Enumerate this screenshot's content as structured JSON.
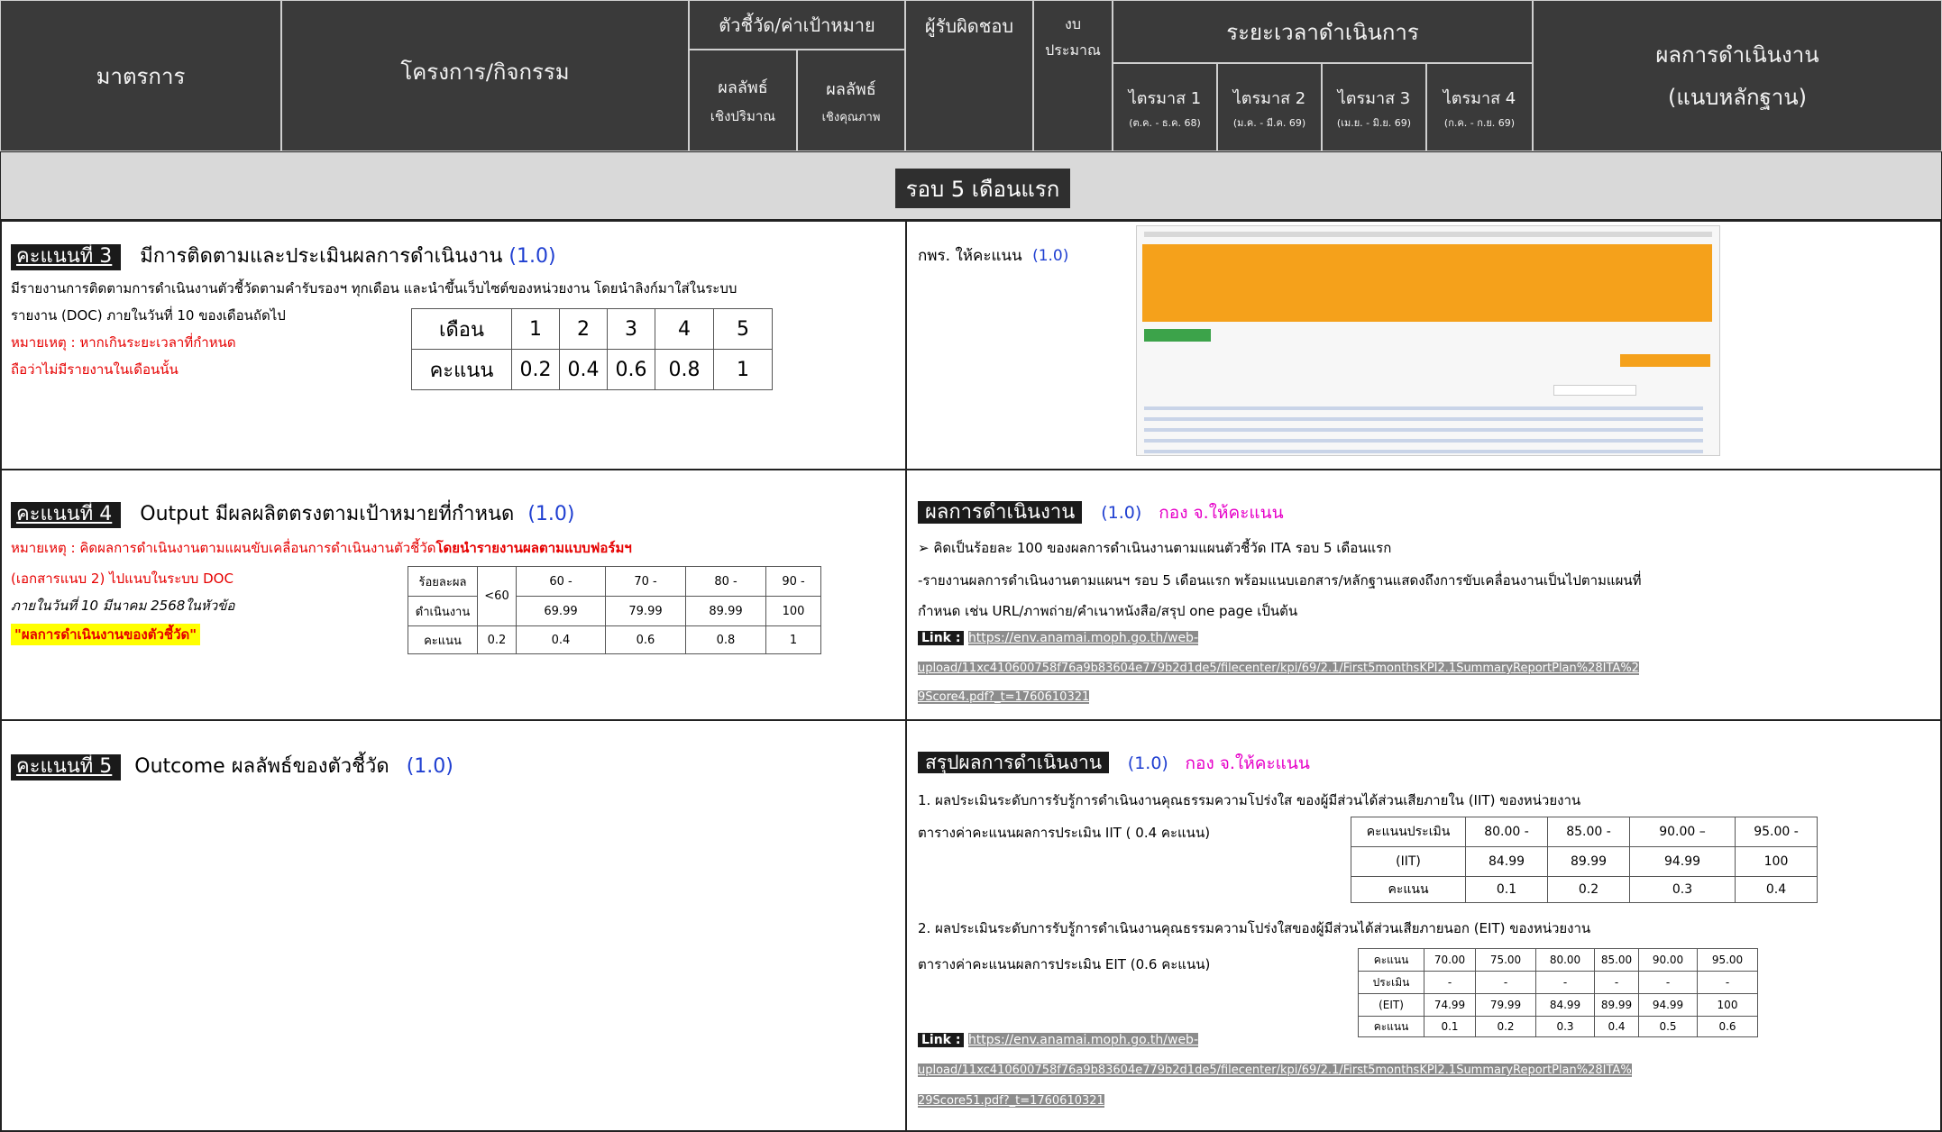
{
  "header": {
    "measure": "มาตรการ",
    "project": "โครงการ/กิจกรรม",
    "indicator": "ตัวชี้วัด/ค่าเป้าหมาย",
    "quantitative_1": "ผลลัพธ์",
    "quantitative_2": "เชิงปริมาณ",
    "qualitative_1": "ผลลัพธ์",
    "qualitative_2": "เชิงคุณภาพ",
    "responsible": "ผู้รับผิดชอบ",
    "budget_1": "งบ",
    "budget_2": "ประมาณ",
    "timeline": "ระยะเวลาดำเนินการ",
    "quarters": [
      {
        "label": "ไตรมาส 1",
        "range": "(ต.ค. - ธ.ค. 68)"
      },
      {
        "label": "ไตรมาส 2",
        "range": "(ม.ค. - มี.ค. 69)"
      },
      {
        "label": "ไตรมาส 3",
        "range": "(เม.ย. - มิ.ย. 69)"
      },
      {
        "label": "ไตรมาส 4",
        "range": "(ก.ค. - ก.ย. 69)"
      }
    ],
    "result_1": "ผลการดำเนินงาน",
    "result_2": "(แนบหลักฐาน)"
  },
  "round_title": "รอบ 5 เดือนแรก",
  "score3": {
    "tag": "คะแนนที่ 3",
    "title": "มีการติดตามและประเมินผลการดำเนินงาน",
    "weight": "(1.0)",
    "desc_1": "มีรายงานการติดตามการดำเนินงานตัวชี้วัดตามคำรับรองฯ ทุกเดือน และนำขึ้นเว็บไซต์ของหน่วยงาน โดยนำลิงก์มาใส่ในระบบ",
    "desc_2": "รายงาน (DOC) ภายในวันที่ 10 ของเดือนถัดไป",
    "note_1": "หมายเหตุ : หากเกินระยะเวลาที่กำหนด",
    "note_2": "ถือว่าไม่มีรายงานในเดือนนั้น",
    "table": {
      "row1_label": "เดือน",
      "months": [
        "1",
        "2",
        "3",
        "4",
        "5"
      ],
      "row2_label": "คะแนน",
      "scores": [
        "0.2",
        "0.4",
        "0.6",
        "0.8",
        "1"
      ]
    },
    "result_text": "กพร. ให้คะแนน",
    "result_weight": "(1.0)"
  },
  "score4": {
    "tag": "คะแนนที่ 4",
    "title": "Output มีผลผลิตตรงตามเป้าหมายที่กำหนด",
    "weight": "(1.0)",
    "note_prefix": "หมายเหตุ : คิดผลการดำเนินงานตามแผนขับเคลื่อนการดำเนินงานตัวชี้วัด",
    "note_suffix": "โดยนำรายงานผลตามแบบฟอร์มฯ",
    "note_2": "(เอกสารแนบ 2) ไปแนบในระบบ DOC",
    "note_3": "ภายในวันที่ 10 มีนาคม 2568ในหัวข้อ",
    "note_4": "\"ผลการดำเนินงานของตัวชี้วัด\"",
    "table": {
      "h1": "ร้อยละผล",
      "h2": "ดำเนินงาน",
      "ranges_top": [
        "<60",
        "60 -",
        "70 -",
        "80 -",
        "90 -"
      ],
      "ranges_bottom": [
        "",
        "69.99",
        "79.99",
        "89.99",
        "100"
      ],
      "score_label": "คะแนน",
      "scores": [
        "0.2",
        "0.4",
        "0.6",
        "0.8",
        "1"
      ]
    },
    "result_tag": "ผลการดำเนินงาน",
    "result_weight": "(1.0)",
    "result_grader": "กอง จ.ให้คะแนน",
    "result_line1": "➢ คิดเป็นร้อยละ 100 ของผลการดำเนินงานตามแผนตัวชี้วัด ITA รอบ 5 เดือนแรก",
    "result_line2": "-รายงานผลการดำเนินงานตามแผนฯ รอบ 5 เดือนแรก พร้อมแนบเอกสาร/หลักฐานแสดงถึงการขับเคลื่อนงานเป็นไปตามแผนที่",
    "result_line3": "กำหนด เช่น URL/ภาพถ่าย/คำเนาหนังสือ/สรุป one page เป็นต้น",
    "link_label": "Link :",
    "link_1": "https://env.anamai.moph.go.th/web-",
    "link_2": "upload/11xc410600758f76a9b83604e779b2d1de5/filecenter/kpi/69/2.1/First5monthsKPI2.1SummaryReportPlan%28ITA%2",
    "link_3": "9Score4.pdf?_t=1760610321"
  },
  "score5": {
    "tag": "คะแนนที่ 5",
    "title": "Outcome ผลลัพธ์ของตัวชี้วัด",
    "weight": "(1.0)",
    "result_tag": "สรุปผลการดำเนินงาน",
    "result_weight": "(1.0)",
    "result_grader": "กอง จ.ให้คะแนน",
    "iit_line": "1. ผลประเมินระดับการรับรู้การดำเนินงานคุณธรรมความโปร่งใส ของผู้มีส่วนได้ส่วนเสียภายใน (IIT) ของหน่วยงาน",
    "iit_caption": "ตารางค่าคะแนนผลการประเมิน IIT ( 0.4 คะแนน)",
    "iit_table": {
      "h1": "คะแนนประเมิน",
      "h2": "(IIT)",
      "ranges_top": [
        "80.00 -",
        "85.00 -",
        "90.00 –",
        "95.00 -"
      ],
      "ranges_bottom": [
        "84.99",
        "89.99",
        "94.99",
        "100"
      ],
      "score_label": "คะแนน",
      "scores": [
        "0.1",
        "0.2",
        "0.3",
        "0.4"
      ]
    },
    "eit_line": "2. ผลประเมินระดับการรับรู้การดำเนินงานคุณธรรมความโปร่งใสของผู้มีส่วนได้ส่วนเสียภายนอก (EIT) ของหน่วยงาน",
    "eit_caption": "ตารางค่าคะแนนผลการประเมิน EIT (0.6 คะแนน)",
    "eit_table": {
      "h1": "คะแนน",
      "h2": "ประเมิน",
      "h3": "(EIT)",
      "ranges_top": [
        "70.00",
        "75.00",
        "80.00",
        "85.00",
        "90.00",
        "95.00"
      ],
      "ranges_mid": [
        "-",
        "-",
        "-",
        "-",
        "-",
        "-"
      ],
      "ranges_bottom": [
        "74.99",
        "79.99",
        "84.99",
        "89.99",
        "94.99",
        "100"
      ],
      "score_label": "คะแนน",
      "scores": [
        "0.1",
        "0.2",
        "0.3",
        "0.4",
        "0.5",
        "0.6"
      ]
    },
    "link_label": "Link :",
    "link_1": "https://env.anamai.moph.go.th/web-",
    "link_2": "upload/11xc410600758f76a9b83604e779b2d1de5/filecenter/kpi/69/2.1/First5monthsKPI2.1SummaryReportPlan%28ITA%",
    "link_3": "29Score51.pdf?_t=1760610321"
  },
  "colors": {
    "header_bg": "#3a3a3a",
    "band_bg": "#d9d9d9",
    "blue": "#1f3fd1",
    "red": "#e60000",
    "magenta": "#e600c8",
    "orange": "#f5a11b"
  }
}
